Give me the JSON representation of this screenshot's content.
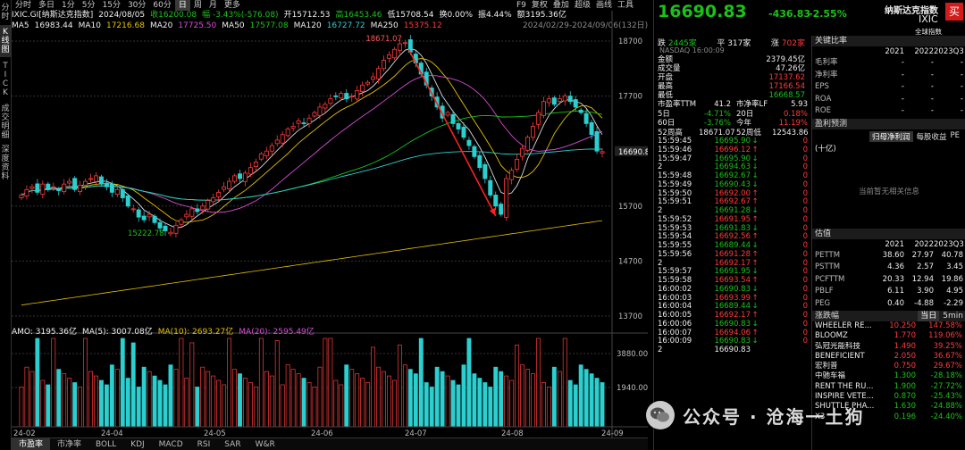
{
  "left_strip": [
    "分时",
    "K线图",
    "TICK",
    "成交明细",
    "深度资料"
  ],
  "periods": [
    "分时",
    "多日",
    "1分",
    "5分",
    "15分",
    "30分",
    "60分",
    "日",
    "周",
    "月",
    "更多"
  ],
  "active_period": "日",
  "tools": [
    "F9",
    "复权",
    "叠加",
    "超级",
    "画线",
    "工具"
  ],
  "info": {
    "line1": [
      {
        "t": "IXIC.GI[纳斯达克指数]",
        "c": "white"
      },
      {
        "t": "2024/08/05",
        "c": "white"
      },
      {
        "t": "收16200.08",
        "c": "green"
      },
      {
        "t": "幅 -3.43%(-576.08)",
        "c": "green"
      },
      {
        "t": "开15712.53",
        "c": "white"
      },
      {
        "t": "高16453.46",
        "c": "green"
      },
      {
        "t": "低15708.54",
        "c": "white"
      },
      {
        "t": "换0.00%",
        "c": "white"
      },
      {
        "t": "振4.44%",
        "c": "white"
      },
      {
        "t": "额3195.36亿",
        "c": "white"
      }
    ],
    "line2": [
      {
        "t": "MA5",
        "c": "white"
      },
      {
        "t": "16983.44",
        "c": "white"
      },
      {
        "t": "MA10",
        "c": "white"
      },
      {
        "t": "17216.68",
        "c": "yel"
      },
      {
        "t": "MA20",
        "c": "white"
      },
      {
        "t": "17725.50",
        "c": "pur"
      },
      {
        "t": "MA50",
        "c": "white"
      },
      {
        "t": "17577.08",
        "c": "green"
      },
      {
        "t": "MA120",
        "c": "white"
      },
      {
        "t": "16727.72",
        "c": "cyan"
      },
      {
        "t": "MA250",
        "c": "white"
      },
      {
        "t": "15375.12",
        "c": "red"
      }
    ],
    "range": "2024/02/29-2024/09/06(132日)"
  },
  "price_axis": [
    "18700",
    "17700",
    "16690.8",
    "15700",
    "14700",
    "13700"
  ],
  "annotations": {
    "high": "18671.07",
    "low": "15222.78"
  },
  "vol_info": [
    {
      "t": "AMO: 3195.36亿",
      "c": "white"
    },
    {
      "t": "MA(5): 3007.08亿",
      "c": "white"
    },
    {
      "t": "MA(10): 2693.27亿",
      "c": "yel"
    },
    {
      "t": "MA(20): 2595.49亿",
      "c": "pur"
    }
  ],
  "vol_axis": [
    "3880.00亿",
    "1940.00亿"
  ],
  "date_axis": [
    "24-02",
    "24-04",
    "24-05",
    "24-06",
    "24-07",
    "24-08",
    "24-09"
  ],
  "bottom_tabs": [
    "市盈率",
    "市净率",
    "BOLL",
    "KDJ",
    "MACD",
    "RSI",
    "SAR",
    "W&R"
  ],
  "active_tab": "市盈率",
  "chart_data": {
    "type": "candlestick",
    "x": [
      "24-02",
      "24-04",
      "24-05",
      "24-06",
      "24-07",
      "24-08",
      "24-09"
    ],
    "ylim": [
      13700,
      18700
    ],
    "approx_closes": [
      15900,
      16000,
      16050,
      15950,
      16100,
      16000,
      16050,
      15980,
      16100,
      16150,
      16000,
      16080,
      16150,
      16200,
      16250,
      16100,
      16050,
      15950,
      16000,
      15850,
      15700,
      15650,
      15500,
      15450,
      15550,
      15400,
      15300,
      15250,
      15223,
      15350,
      15450,
      15550,
      15650,
      15600,
      15700,
      15800,
      15850,
      15950,
      16050,
      16150,
      16250,
      16200,
      16300,
      16400,
      16500,
      16650,
      16700,
      16800,
      16900,
      17000,
      17100,
      17150,
      17250,
      17200,
      17300,
      17400,
      17500,
      17550,
      17650,
      17700,
      17750,
      17650,
      17700,
      17800,
      17900,
      17950,
      18050,
      18200,
      18350,
      18450,
      18550,
      18650,
      18671,
      18500,
      18300,
      18100,
      17900,
      17700,
      17500,
      17300,
      17400,
      17200,
      17100,
      16950,
      16800,
      16600,
      16400,
      16200,
      15900,
      15700,
      15550,
      16200,
      16350,
      16550,
      16750,
      16950,
      17150,
      17400,
      17600,
      17650,
      17550,
      17650,
      17700,
      17600,
      17500,
      17400,
      17200,
      17000,
      16700,
      16690
    ]
  },
  "quote": {
    "price": "16690.83",
    "change": "-436.83",
    "pct": "-2.55%",
    "name": "纳斯达克指数",
    "code": "IXIC",
    "buy": "买",
    "global": "全球指数",
    "breadth": {
      "down_label": "跌",
      "down": "2445家",
      "flat_label": "平",
      "flat": "317家",
      "up_label": "涨",
      "up": "702家"
    },
    "market": "NASDAQ 16:00:09",
    "stats": [
      {
        "k": "金额",
        "v": "2379.45亿",
        "c": "white"
      },
      {
        "k": "成交量",
        "v": "47.26亿",
        "c": "white"
      },
      {
        "k": "开盘",
        "v": "17137.62",
        "c": "red"
      },
      {
        "k": "最高",
        "v": "17166.54",
        "c": "red"
      },
      {
        "k": "最低",
        "v": "16668.57",
        "c": "green"
      }
    ],
    "ratios": [
      {
        "k1": "市盈率TTM",
        "v1": "41.2",
        "c1": "white",
        "k2": "市净率LF",
        "v2": "5.93",
        "c2": "white"
      },
      {
        "k1": "5日",
        "v1": "-4.71%",
        "c1": "green",
        "k2": "20日",
        "v2": "0.18%",
        "c2": "red"
      },
      {
        "k1": "60日",
        "v1": "-3.76%",
        "c1": "green",
        "k2": "今年",
        "v2": "11.19%",
        "c2": "red"
      },
      {
        "k1": "52周高",
        "v1": "18671.07",
        "c1": "white",
        "k2": "52周低",
        "v2": "12543.86",
        "c2": "white"
      }
    ],
    "ticks": [
      {
        "t": "15:59:45",
        "p": "16695.90",
        "c": "green",
        "a": "↓",
        "v": "0"
      },
      {
        "t": "15:59:46",
        "p": "16696.12",
        "c": "red",
        "a": "↑",
        "v": "0"
      },
      {
        "t": "15:59:47",
        "p": "16695.90",
        "c": "green",
        "a": "↓",
        "v": "0"
      },
      {
        "t": "2",
        "p": "16694.63",
        "c": "green",
        "a": "↓",
        "v": "0"
      },
      {
        "t": "15:59:48",
        "p": "16692.67",
        "c": "green",
        "a": "↓",
        "v": "0"
      },
      {
        "t": "15:59:49",
        "p": "16690.43",
        "c": "green",
        "a": "↓",
        "v": "0"
      },
      {
        "t": "15:59:50",
        "p": "16692.00",
        "c": "red",
        "a": "↑",
        "v": "0"
      },
      {
        "t": "15:59:51",
        "p": "16692.67",
        "c": "red",
        "a": "↑",
        "v": "0"
      },
      {
        "t": "2",
        "p": "16691.28",
        "c": "green",
        "a": "↓",
        "v": "0"
      },
      {
        "t": "15:59:52",
        "p": "16691.95",
        "c": "red",
        "a": "↑",
        "v": "0"
      },
      {
        "t": "15:59:53",
        "p": "16691.83",
        "c": "green",
        "a": "↓",
        "v": "0"
      },
      {
        "t": "15:59:54",
        "p": "16692.56",
        "c": "red",
        "a": "↑",
        "v": "0"
      },
      {
        "t": "15:59:55",
        "p": "16689.44",
        "c": "green",
        "a": "↓",
        "v": "0"
      },
      {
        "t": "15:59:56",
        "p": "16691.28",
        "c": "red",
        "a": "↑",
        "v": "0"
      },
      {
        "t": "2",
        "p": "16692.17",
        "c": "red",
        "a": "↑",
        "v": "0"
      },
      {
        "t": "15:59:57",
        "p": "16691.95",
        "c": "green",
        "a": "↓",
        "v": "0"
      },
      {
        "t": "15:59:58",
        "p": "16693.54",
        "c": "red",
        "a": "↑",
        "v": "0"
      },
      {
        "t": "16:00:02",
        "p": "16690.83",
        "c": "green",
        "a": "↓",
        "v": "0"
      },
      {
        "t": "16:00:03",
        "p": "16693.99",
        "c": "red",
        "a": "↑",
        "v": "0"
      },
      {
        "t": "16:00:04",
        "p": "16689.44",
        "c": "green",
        "a": "↓",
        "v": "0"
      },
      {
        "t": "16:00:05",
        "p": "16692.17",
        "c": "red",
        "a": "↑",
        "v": "0"
      },
      {
        "t": "16:00:06",
        "p": "16690.83",
        "c": "green",
        "a": "↓",
        "v": "0"
      },
      {
        "t": "16:00:07",
        "p": "16694.06",
        "c": "red",
        "a": "↑",
        "v": "0"
      },
      {
        "t": "16:00:09",
        "p": "16690.83",
        "c": "green",
        "a": "↓",
        "v": "0"
      },
      {
        "t": "2",
        "p": "16690.83",
        "c": "white",
        "a": "",
        "v": ""
      }
    ]
  },
  "fundamentals": {
    "title": "关键比率",
    "years": [
      "2021",
      "2022",
      "2023Q3"
    ],
    "rows": [
      {
        "k": "毛利率",
        "v": [
          "-",
          "-",
          "-"
        ]
      },
      {
        "k": "净利率",
        "v": [
          "-",
          "-",
          "-"
        ]
      },
      {
        "k": "EPS",
        "v": [
          "-",
          "-",
          "-"
        ]
      },
      {
        "k": "ROA",
        "v": [
          "-",
          "-",
          "-"
        ]
      },
      {
        "k": "ROE",
        "v": [
          "-",
          "-",
          "-"
        ]
      }
    ],
    "profit_title": "盈利预测",
    "profit_tabs": [
      "归母净利润",
      "每股收益",
      "PE"
    ],
    "unit": "(十亿)",
    "no_data": "当前暂无相关信息",
    "val_title": "估值",
    "val_years": [
      "2021",
      "2022",
      "2023Q3"
    ],
    "val_rows": [
      {
        "k": "PE",
        "s": "TTM",
        "v": [
          "38.60",
          "27.97",
          "40.78"
        ]
      },
      {
        "k": "PS",
        "s": "TTM",
        "v": [
          "4.36",
          "2.57",
          "3.45"
        ]
      },
      {
        "k": "PCF",
        "s": "TTM",
        "v": [
          "20.33",
          "12.94",
          "19.86"
        ]
      },
      {
        "k": "PB",
        "s": "LF",
        "v": [
          "6.11",
          "3.90",
          "4.95"
        ]
      },
      {
        "k": "PEG",
        "s": "",
        "v": [
          "0.40",
          "-4.88",
          "-2.29"
        ]
      }
    ],
    "mover_title": "涨跌幅",
    "mover_tabs": [
      "当日",
      "5min"
    ],
    "movers": [
      {
        "n": "WHEELER RE...",
        "p": "10.250",
        "c": "red",
        "g": "147.58%"
      },
      {
        "n": "BLOOMZ",
        "p": "1.770",
        "c": "red",
        "g": "119.06%"
      },
      {
        "n": "弘冠光能科技",
        "p": "1.490",
        "c": "red",
        "g": "39.25%"
      },
      {
        "n": "BENEFICIENT",
        "p": "2.050",
        "c": "red",
        "g": "36.67%"
      },
      {
        "n": "宏利普",
        "p": "0.750",
        "c": "red",
        "g": "29.67%"
      },
      {
        "n": "中驰车福",
        "p": "1.300",
        "c": "green",
        "g": "-28.18%"
      },
      {
        "n": "RENT THE RU...",
        "p": "1.900",
        "c": "green",
        "g": "-27.72%"
      },
      {
        "n": "INSPIRE VETE...",
        "p": "0.870",
        "c": "green",
        "g": "-25.43%"
      },
      {
        "n": "SHUTTLE PHA...",
        "p": "1.630",
        "c": "green",
        "g": "-24.88%"
      },
      {
        "n": "X3",
        "p": "0.196",
        "c": "green",
        "g": "-24.40%"
      }
    ]
  },
  "watermark": "公众号 · 沧海一土狗"
}
